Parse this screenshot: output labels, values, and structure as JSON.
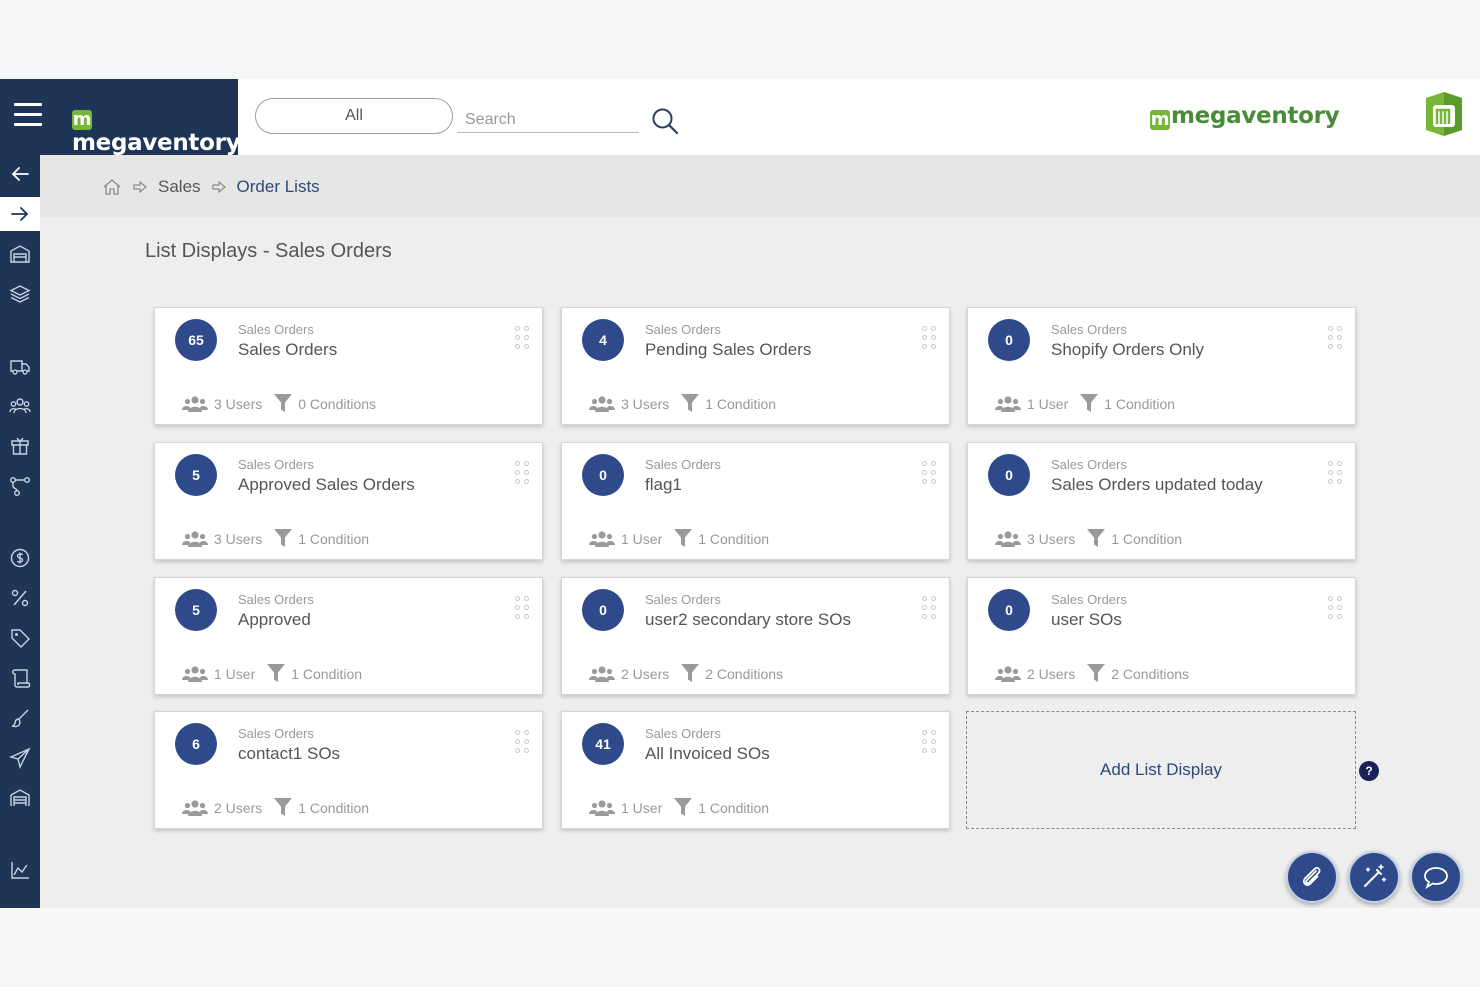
{
  "header": {
    "brand": "megaventory",
    "brand_right": "megaventory",
    "filter": "All",
    "search_placeholder": "Search"
  },
  "breadcrumb": {
    "items": [
      "Sales",
      "Order Lists"
    ]
  },
  "page": {
    "title": "List Displays - Sales Orders"
  },
  "cards": [
    {
      "count": "65",
      "type": "Sales Orders",
      "name": "Sales Orders",
      "users": "3 Users",
      "conditions": "0 Conditions"
    },
    {
      "count": "4",
      "type": "Sales Orders",
      "name": "Pending Sales Orders",
      "users": "3 Users",
      "conditions": "1 Condition"
    },
    {
      "count": "0",
      "type": "Sales Orders",
      "name": "Shopify Orders Only",
      "users": "1 User",
      "conditions": "1 Condition"
    },
    {
      "count": "5",
      "type": "Sales Orders",
      "name": "Approved Sales Orders",
      "users": "3 Users",
      "conditions": "1 Condition"
    },
    {
      "count": "0",
      "type": "Sales Orders",
      "name": "flag1",
      "users": "1 User",
      "conditions": "1 Condition"
    },
    {
      "count": "0",
      "type": "Sales Orders",
      "name": "Sales Orders updated today",
      "users": "3 Users",
      "conditions": "1 Condition"
    },
    {
      "count": "5",
      "type": "Sales Orders",
      "name": "Approved",
      "users": "1 User",
      "conditions": "1 Condition"
    },
    {
      "count": "0",
      "type": "Sales Orders",
      "name": "user2 secondary store SOs",
      "users": "2 Users",
      "conditions": "2 Conditions"
    },
    {
      "count": "0",
      "type": "Sales Orders",
      "name": "user SOs",
      "users": "2 Users",
      "conditions": "2 Conditions"
    },
    {
      "count": "6",
      "type": "Sales Orders",
      "name": "contact1 SOs",
      "users": "2 Users",
      "conditions": "1 Condition"
    },
    {
      "count": "41",
      "type": "Sales Orders",
      "name": "All Invoiced SOs",
      "users": "1 User",
      "conditions": "1 Condition"
    }
  ],
  "add_card": {
    "label": "Add List Display"
  },
  "help": {
    "label": "?"
  },
  "sidebar": {
    "icons": [
      "arrow-left-icon",
      "arrow-right-icon",
      "warehouse-icon",
      "layers-icon",
      "truck-icon",
      "users-icon",
      "box-icon",
      "workflow-icon",
      "dollar-icon",
      "percent-icon",
      "tag-icon",
      "scroll-icon",
      "brush-icon",
      "send-icon",
      "garage-icon",
      "chart-icon"
    ]
  },
  "fabs": [
    "paperclip-icon",
    "magic-wand-icon",
    "chat-icon"
  ],
  "colors": {
    "navy": "#1f3556",
    "badge": "#2f4a8a",
    "brand_green": "#78b63a",
    "link": "#2e4a7a"
  }
}
